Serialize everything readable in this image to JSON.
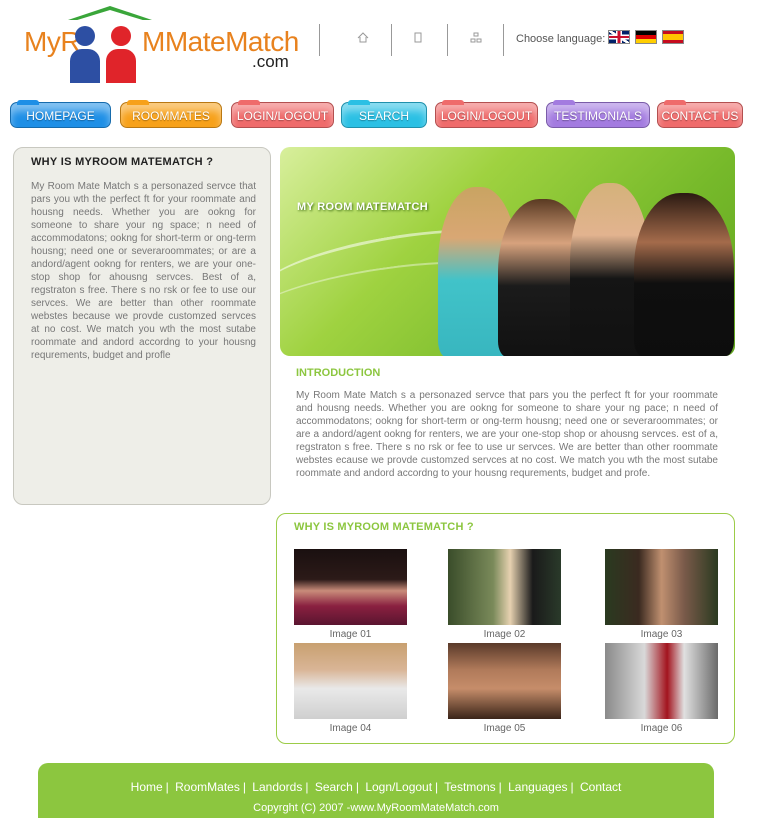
{
  "brand": {
    "part1": "MyR",
    "part2": "MMateMatch",
    "tld": ".com"
  },
  "header": {
    "language_label": "Choose language:",
    "flags": [
      "uk-flag",
      "germany-flag",
      "spain-flag"
    ]
  },
  "nav": [
    {
      "label": "HOMEPAGE",
      "color": "#1e8fe6"
    },
    {
      "label": "ROOMMATES",
      "color": "#f7a11a"
    },
    {
      "label": "LOGIN/LOGOUT",
      "color": "#ef6b6b"
    },
    {
      "label": "SEARCH",
      "color": "#2bc0e4"
    },
    {
      "label": "LOGIN/LOGOUT",
      "color": "#ef6b6b"
    },
    {
      "label": "TESTIMONIALS",
      "color": "#a37be0"
    },
    {
      "label": "CONTACT US",
      "color": "#ef6b6b"
    }
  ],
  "sidebar": {
    "title": "WHY IS MYROOM MATEMATCH ?",
    "text": "My Room Mate Match s a personazed servce that pars you wth the perfect ft for your roommate and housng needs. Whether you are ookng for someone to share your ng space; n need of accommodatons; ookng for short-term or ong-term housng; need one or severaroommates; or are a andord/agent ookng for renters, we are your one-stop shop for ahousng servces. Best of a, regstraton s free. There s no rsk or fee to use our servces. We are better than other roommate webstes because we provde customzed servces at no cost. We match you wth the most sutabe roommate and andord accordng to your housng requrements, budget and profle"
  },
  "hero": {
    "title": "MY ROOM MATEMATCH"
  },
  "intro": {
    "title": "INTRODUCTION",
    "text": "My Room Mate Match s a personazed servce that pars you the perfect ft for your roommate and housng needs. Whether you are ookng for someone to share your ng pace; n need of accommodatons; ookng for short-term or ong-term housng; need one or severaroommates; or are a andord/agent ookng for renters, we are your one-stop shop or ahousng servces. est of a, regstraton s free. There s no rsk or fee to use ur servces. We are better than other roommate webstes ecause we provde customzed servces at no cost. We match you wth the most sutabe roommate and andord accordng to your housng requrements, budget and profe."
  },
  "gallery": {
    "title": "WHY IS MYROOM MATEMATCH ?",
    "images": [
      {
        "caption": "Image 01"
      },
      {
        "caption": "Image 02"
      },
      {
        "caption": "Image 03"
      },
      {
        "caption": "Image 04"
      },
      {
        "caption": "Image 05"
      },
      {
        "caption": "Image 06"
      }
    ]
  },
  "footer": {
    "links": [
      "Home",
      "RoomMates",
      "Landords",
      "Search",
      "Logn/Logout",
      "Testmons",
      "Languages",
      "Contact"
    ],
    "copyright": "Copyrght (C) 2007 -www.MyRoomMateMatch.com"
  },
  "colors": {
    "accent_green": "#8cc63f",
    "logo_orange": "#e8821e",
    "logo_green": "#3aa63a"
  }
}
